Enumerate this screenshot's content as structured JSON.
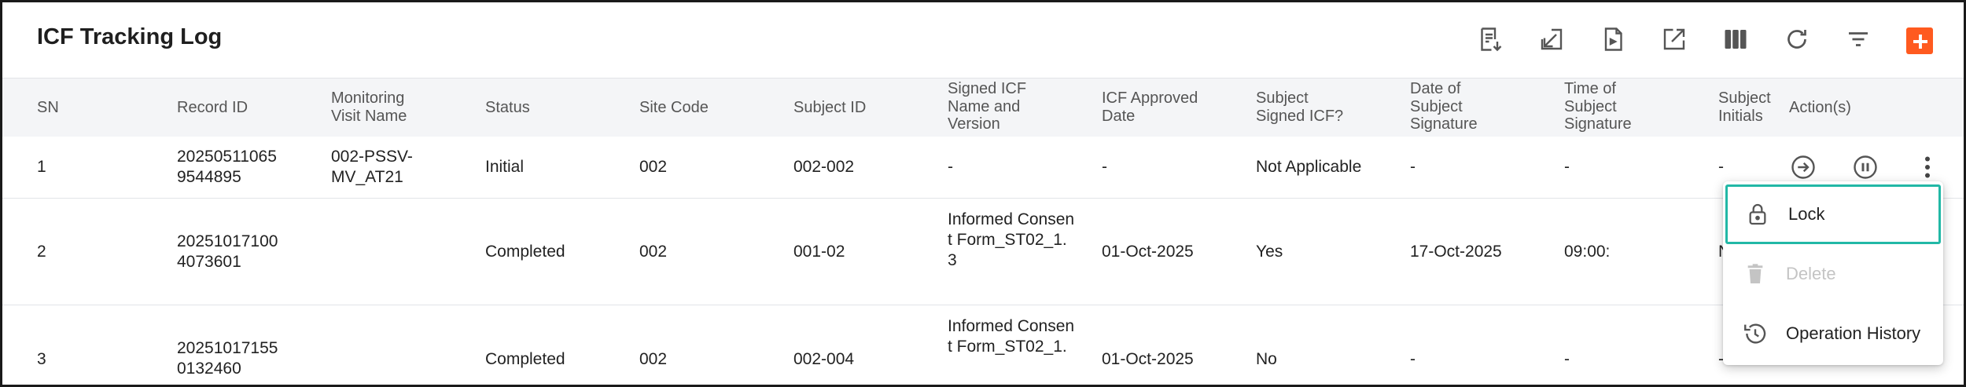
{
  "title": "ICF Tracking Log",
  "toolbar": {
    "icons": [
      "export-list-icon",
      "import-icon",
      "pdf-export-icon",
      "open-external-icon",
      "columns-icon",
      "refresh-icon",
      "filter-icon",
      "add-icon"
    ],
    "accent_color": "#ff5a1f"
  },
  "table": {
    "headers": {
      "sn": "SN",
      "record_id": "Record ID",
      "monitoring_visit_name": "Monitoring Visit Name",
      "status": "Status",
      "site_code": "Site Code",
      "subject_id": "Subject ID",
      "signed_icf_name": "Signed ICF Name and Version",
      "icf_approved_date": "ICF Approved Date",
      "subject_signed": "Subject Signed ICF?",
      "date_signature": "Date of Subject Signature",
      "time_signature": "Time of Subject Signature",
      "subject_initials": "Subject Initials",
      "actions": "Action(s)"
    },
    "rows": [
      {
        "sn": "1",
        "record_id": "20250511065 9544895",
        "monitoring_visit_name": "002-PSSV- MV_AT21",
        "status": "Initial",
        "site_code": "002",
        "subject_id": "002-002",
        "signed_icf_name": "-",
        "icf_approved_date": "-",
        "subject_signed": "Not Applicable",
        "date_signature": "-",
        "time_signature": "-",
        "subject_initials": "-"
      },
      {
        "sn": "2",
        "record_id": "20251017100 4073601",
        "monitoring_visit_name": "",
        "status": "Completed",
        "site_code": "002",
        "subject_id": "001-02",
        "signed_icf_name": "Informed Consent Form_ST02_1. 3",
        "icf_approved_date": "01-Oct-2025",
        "subject_signed": "Yes",
        "date_signature": "17-Oct-2025",
        "time_signature": "09:00:",
        "subject_initials": "N"
      },
      {
        "sn": "3",
        "record_id": "20251017155 0132460",
        "monitoring_visit_name": "",
        "status": "Completed",
        "site_code": "002",
        "subject_id": "002-004",
        "signed_icf_name": "Informed Consent Form_ST02_1.",
        "icf_approved_date": "01-Oct-2025",
        "subject_signed": "No",
        "date_signature": "-",
        "time_signature": "-",
        "subject_initials": "-"
      }
    ]
  },
  "context_menu": {
    "items": [
      {
        "label": "Lock",
        "icon": "lock-icon",
        "state": "highlighted"
      },
      {
        "label": "Delete",
        "icon": "trash-icon",
        "state": "disabled"
      },
      {
        "label": "Operation History",
        "icon": "history-icon",
        "state": "enabled"
      }
    ],
    "highlight_color": "#22b8a6"
  }
}
